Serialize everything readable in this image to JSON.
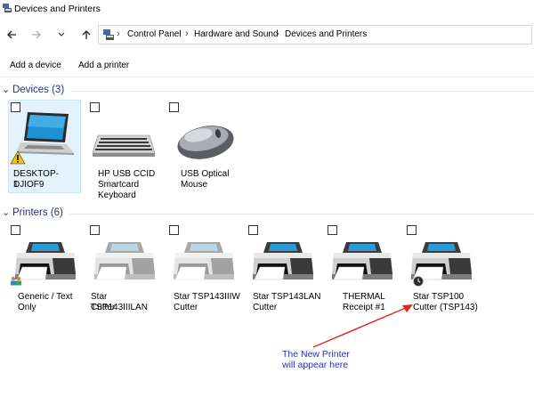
{
  "window": {
    "title": "Devices and Printers"
  },
  "address": {
    "crumbs": [
      "Control Panel",
      "Hardware and Sound",
      "Devices and Printers"
    ]
  },
  "toolbar": {
    "add_device": "Add a device",
    "add_printer": "Add a printer"
  },
  "devices_group": {
    "title": "Devices (3)"
  },
  "printers_group": {
    "title": "Printers (6)"
  },
  "devices": [
    {
      "label1": "DESKTOP-DJIOF9",
      "label2": "1",
      "icon": "laptop-icon",
      "warning": true,
      "selected": true
    },
    {
      "label1": "HP USB CCID",
      "label2": "Smartcard",
      "label3": "Keyboard",
      "icon": "keyboard-icon"
    },
    {
      "label1": "USB Optical",
      "label2": "Mouse",
      "icon": "mouse-icon"
    }
  ],
  "printers": [
    {
      "label1": "Generic / Text",
      "label2": "Only",
      "icon": "printer-icon",
      "badge": "shared-users-icon"
    },
    {
      "label1": "Star TSP143IIILAN",
      "label2": "Cutter",
      "icon": "printer-icon",
      "faded": true
    },
    {
      "label1": "Star TSP143IIIW",
      "label2": "Cutter",
      "icon": "printer-icon",
      "faded": true
    },
    {
      "label1": "Star TSP143LAN",
      "label2": "Cutter",
      "icon": "printer-icon"
    },
    {
      "label1": "THERMAL",
      "label2": "Receipt #1",
      "icon": "printer-icon"
    },
    {
      "label1": "Star TSP100",
      "label2": "Cutter (TSP143)",
      "icon": "printer-icon",
      "badge": "clock-icon"
    }
  ],
  "annotation": {
    "line1": "The New Printer",
    "line2": "will appear here",
    "color": "#1f30c9",
    "arrow_color": "#e0261f"
  }
}
